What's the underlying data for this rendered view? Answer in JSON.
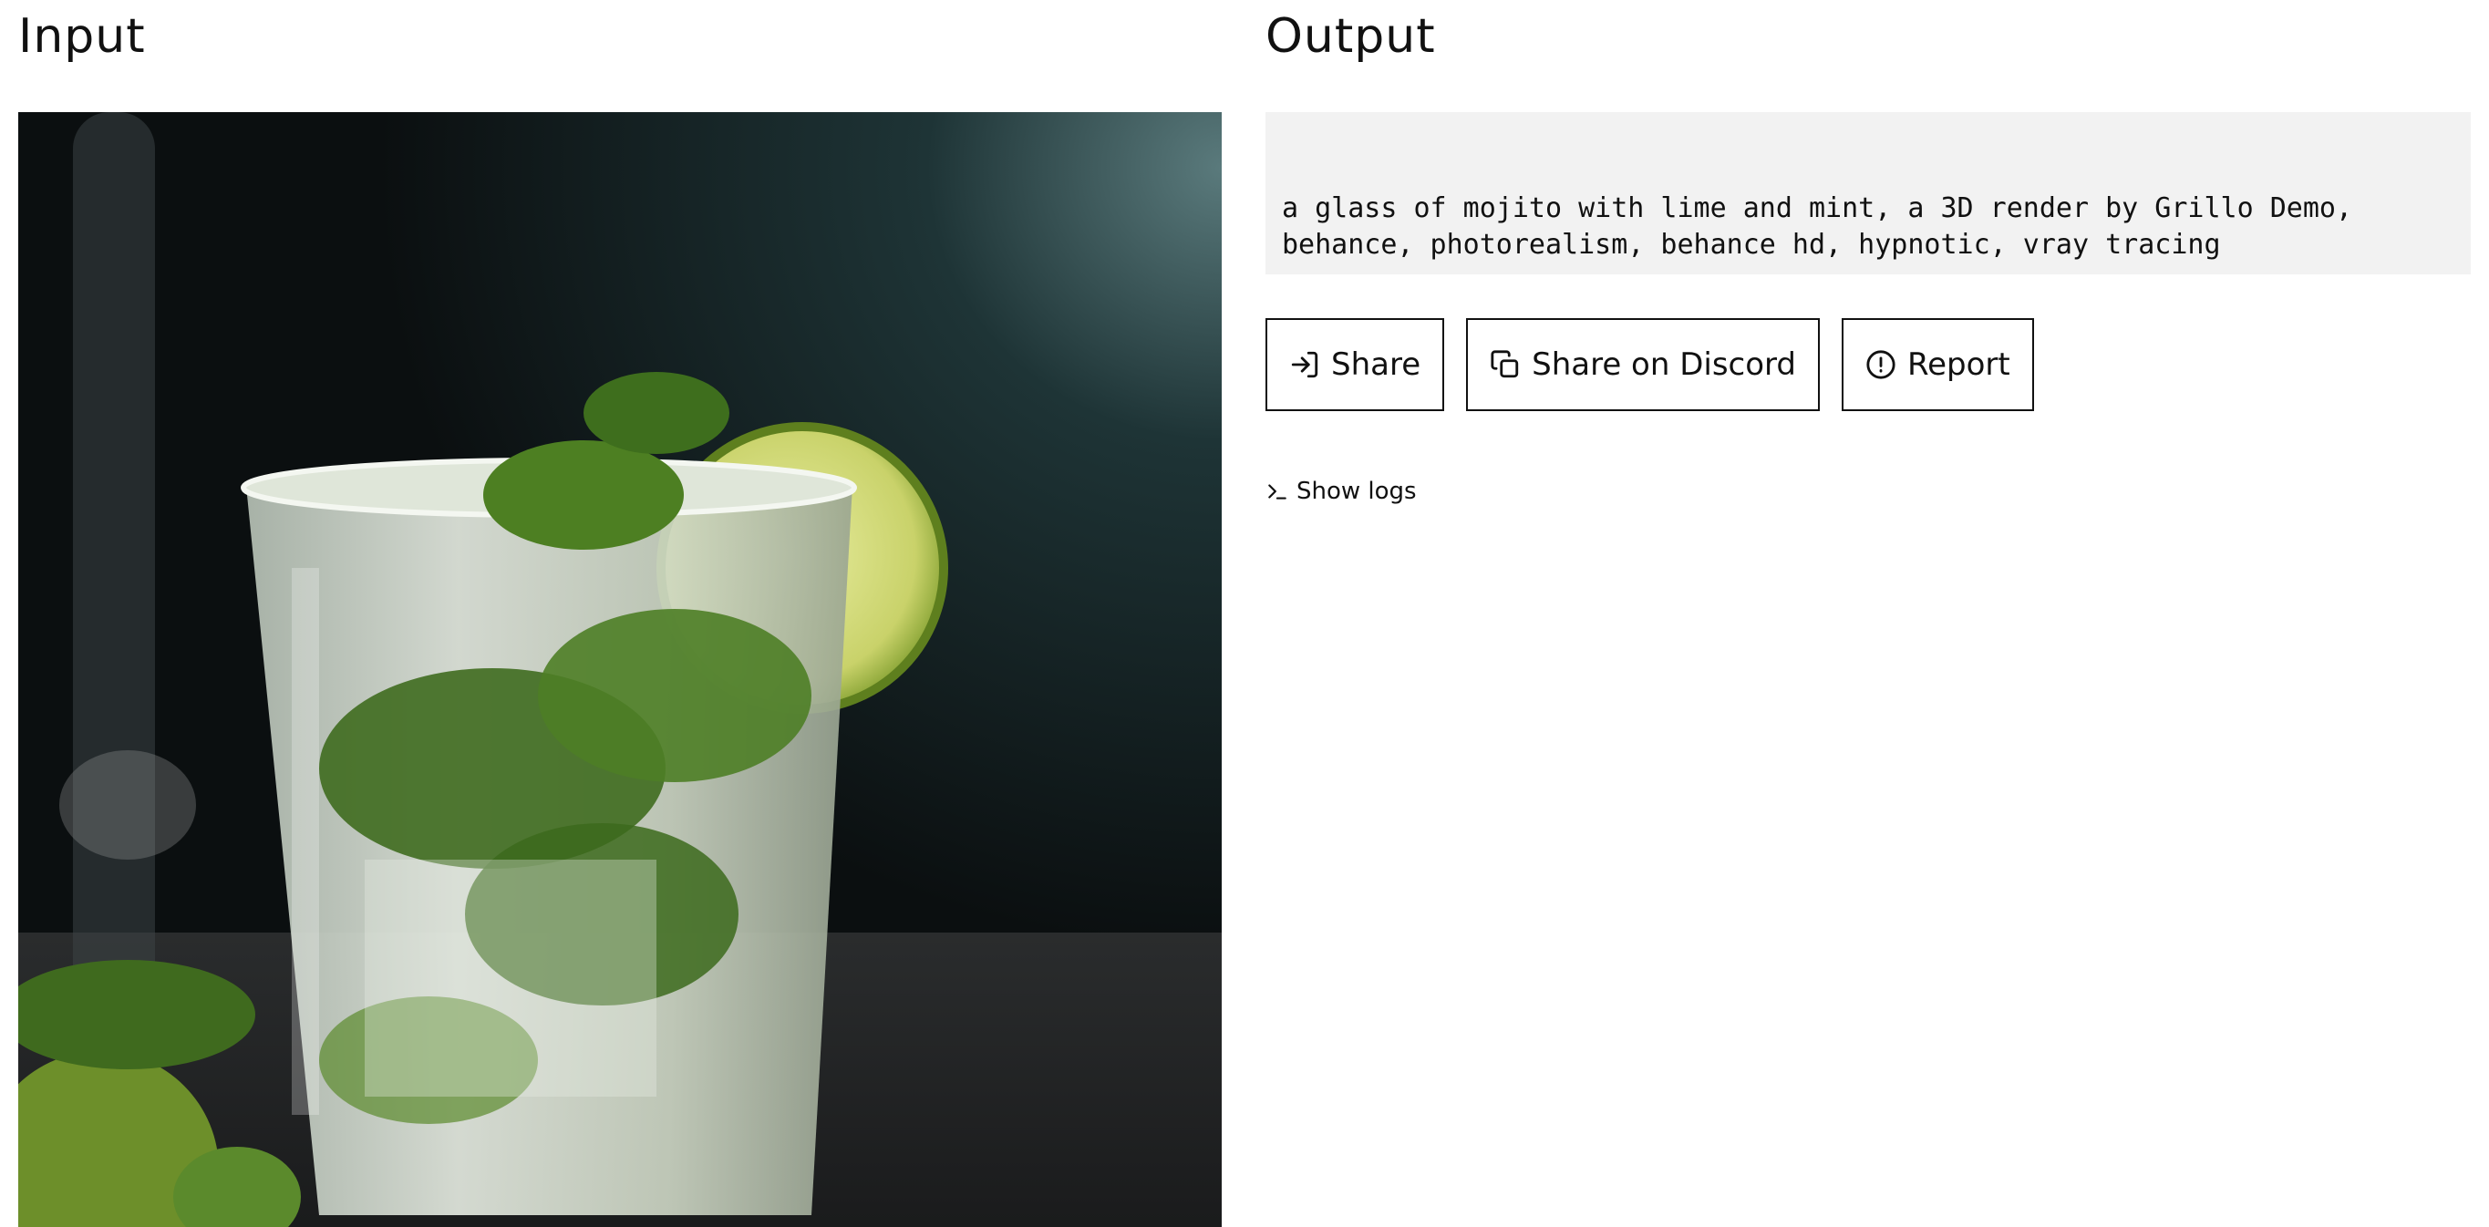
{
  "input": {
    "heading": "Input",
    "image_subject": "mojito-glass-photo"
  },
  "output": {
    "heading": "Output",
    "text": "a glass of mojito with lime and mint, a 3D render by Grillo Demo, behance, photorealism, behance hd, hypnotic, vray tracing"
  },
  "actions": {
    "share_label": "Share",
    "share_icon": "share-arrow-icon",
    "discord_label": "Share on Discord",
    "discord_icon": "copy-icon",
    "report_label": "Report",
    "report_icon": "alert-icon"
  },
  "logs": {
    "label": "Show logs",
    "icon": "terminal-prompt-icon"
  },
  "colors": {
    "output_bg": "#f2f2f2",
    "border": "#111111",
    "image_bg": "#101416"
  }
}
